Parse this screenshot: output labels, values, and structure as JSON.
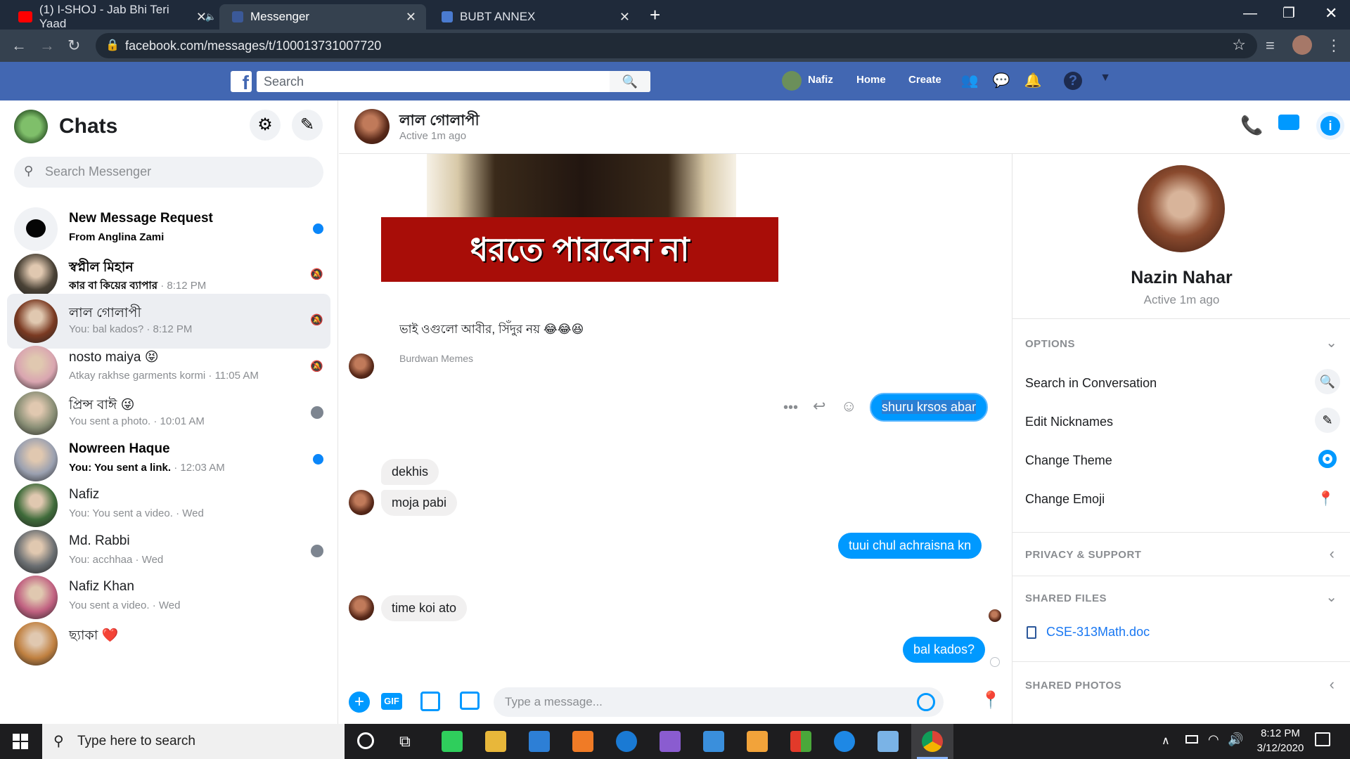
{
  "browser": {
    "tabs": [
      {
        "title": "(1) I-SHOJ - Jab Bhi Teri Yaad",
        "fav_color": "#ff0000"
      },
      {
        "title": "Messenger",
        "fav_color": "#3b5998"
      },
      {
        "title": "BUBT ANNEX",
        "fav_color": "#4a7bd0"
      }
    ],
    "url": "facebook.com/messages/t/100013731007720"
  },
  "fbbar": {
    "search_placeholder": "Search",
    "user": "Nafiz",
    "home": "Home",
    "create": "Create"
  },
  "sidebar": {
    "title": "Chats",
    "search_placeholder": "Search Messenger",
    "chats": [
      {
        "name": "New Message Request",
        "sub": "From Anglina Zami",
        "time": "",
        "bold": true,
        "indicator": "dot",
        "avatar_color": "#f0f2f5"
      },
      {
        "name": "স্বপ্নীল মিহান",
        "sub": "কার বা কিয়ের ব্যাপার",
        "time": " · 8:12 PM",
        "bold": true,
        "indicator": "mute",
        "avatar_color": "#4a4236"
      },
      {
        "name": "লাল গোলাপী",
        "sub": "You: bal kados?",
        "time": " · 8:12 PM",
        "bold": false,
        "indicator": "mute",
        "avatar_color": "#7a3a22",
        "selected": true
      },
      {
        "name": "nosto maiya 😝",
        "sub": "Atkay rakhse garments kormi",
        "time": " · 11:05 AM",
        "bold": false,
        "indicator": "mute",
        "avatar_color": "#d9a5b0"
      },
      {
        "name": "প্রিন্স বাঈ 😜",
        "sub": "You sent a photo.",
        "time": " · 10:01 AM",
        "bold": false,
        "indicator": "seen",
        "avatar_color": "#8a8f76"
      },
      {
        "name": "Nowreen Haque",
        "sub": "You: You sent a link.",
        "time": " · 12:03 AM",
        "bold": true,
        "indicator": "dot",
        "avatar_color": "#9aa0b0"
      },
      {
        "name": "Nafiz",
        "sub": "You: You sent a video.",
        "time": " · Wed",
        "bold": false,
        "indicator": "",
        "avatar_color": "#3f6b3a"
      },
      {
        "name": "Md. Rabbi",
        "sub": "You: acchhaa",
        "time": " · Wed",
        "bold": false,
        "indicator": "seen",
        "avatar_color": "#6b6f72"
      },
      {
        "name": "Nafiz Khan",
        "sub": "You sent a video.",
        "time": " · Wed",
        "bold": false,
        "indicator": "",
        "avatar_color": "#c06080"
      },
      {
        "name": "ছ্যাকা ❤️",
        "sub": "",
        "time": "",
        "bold": false,
        "indicator": "",
        "avatar_color": "#c08040"
      }
    ]
  },
  "conversation": {
    "name": "লাল গোলাপী",
    "status": "Active 1m ago",
    "meme_text": "ধরতে পারবেন না",
    "caption": "ভাই ওগুলো আবীর, সিঁদুর নয় 😂😂😆",
    "source": "Burdwan Memes",
    "messages": [
      {
        "dir": "out",
        "text": "shuru krsos abar"
      },
      {
        "dir": "in",
        "text": "dekhis"
      },
      {
        "dir": "in",
        "text": "moja pabi"
      },
      {
        "dir": "out",
        "text": "tuui chul achraisna kn"
      },
      {
        "dir": "in",
        "text": "time koi ato"
      },
      {
        "dir": "out",
        "text": "bal kados?"
      }
    ],
    "composer_placeholder": "Type a message..."
  },
  "details": {
    "name": "Nazin Nahar",
    "status": "Active 1m ago",
    "options_header": "OPTIONS",
    "options": [
      "Search in Conversation",
      "Edit Nicknames",
      "Change Theme",
      "Change Emoji"
    ],
    "privacy_header": "PRIVACY & SUPPORT",
    "files_header": "SHARED FILES",
    "file_name": "CSE-313Math.doc",
    "photos_header": "SHARED PHOTOS"
  },
  "taskbar": {
    "search_placeholder": "Type here to search",
    "time": "8:12 PM",
    "date": "3/12/2020"
  }
}
